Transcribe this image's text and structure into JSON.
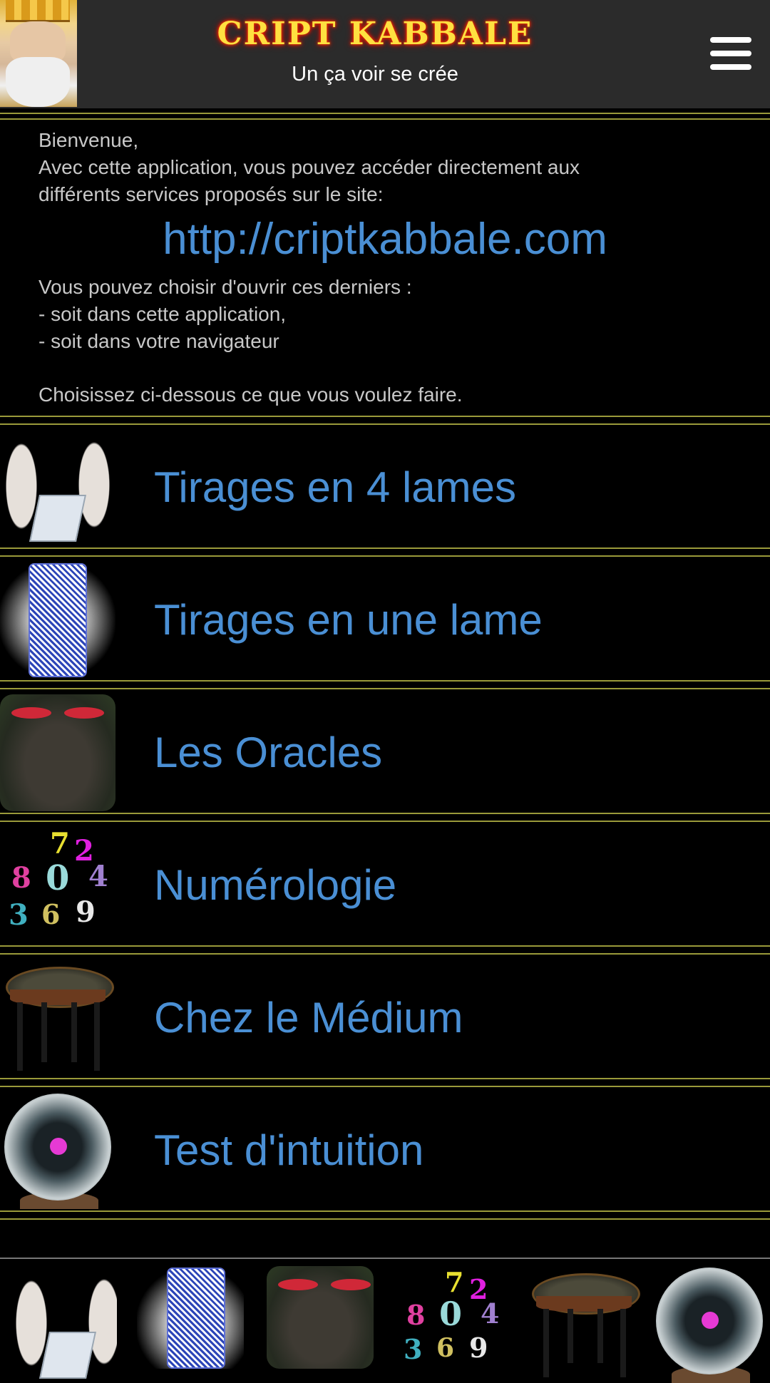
{
  "header": {
    "title": "CRIPT KABBALE",
    "subtitle": "Un ça voir se crée",
    "menu_icon": "hamburger-menu-icon"
  },
  "intro": {
    "line1": "Bienvenue,",
    "line2": "Avec cette application, vous pouvez accéder directement aux",
    "line3": "différents services proposés sur le site:",
    "link": "http://criptkabbale.com",
    "line4": "Vous pouvez choisir d'ouvrir ces derniers :",
    "line5": "- soit dans cette application,",
    "line6": "- soit dans votre navigateur",
    "line7": "Choisissez ci-dessous ce que vous voulez faire."
  },
  "menu": [
    {
      "label": "Tirages en 4 lames",
      "icon": "hands-book-icon"
    },
    {
      "label": "Tirages en une lame",
      "icon": "card-back-icon"
    },
    {
      "label": "Les Oracles",
      "icon": "oracle-face-icon"
    },
    {
      "label": "Numérologie",
      "icon": "numbers-icon"
    },
    {
      "label": "Chez le Médium",
      "icon": "medium-table-icon"
    },
    {
      "label": "Test d'intuition",
      "icon": "crystal-ball-icon"
    }
  ],
  "bottom_nav": [
    "hands-book-icon",
    "card-back-icon",
    "oracle-face-icon",
    "numbers-icon",
    "medium-table-icon",
    "crystal-ball-icon"
  ],
  "colors": {
    "background": "#000000",
    "header_bg": "#2b2b2b",
    "link": "#4a8fd4",
    "title": "#ffe040",
    "divider": "#9a9a3a"
  }
}
